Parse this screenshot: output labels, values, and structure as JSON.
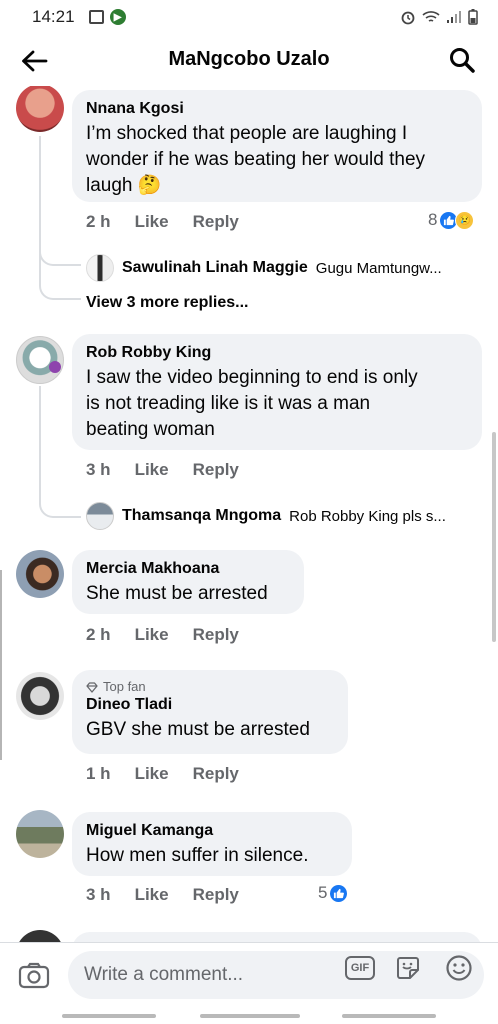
{
  "status_bar": {
    "time": "14:21"
  },
  "header": {
    "title": "MaNgcobo Uzalo"
  },
  "comments": [
    {
      "author": "Nnana Kgosi",
      "text_lines": [
        "I’m shocked that people are laughing I",
        "wonder if he was beating her would they",
        "laugh 🤔"
      ],
      "time": "2 h",
      "like_label": "Like",
      "reply_label": "Reply",
      "reaction_count": "8",
      "reply_preview": {
        "name": "Sawulinah Linah Maggie",
        "snippet": "Gugu Mamtungw..."
      },
      "more_replies": "View 3 more replies..."
    },
    {
      "author": "Rob Robby King",
      "text_lines": [
        "I saw the video beginning to end is only",
        "is not treading like is it was a man",
        "beating woman"
      ],
      "time": "3 h",
      "like_label": "Like",
      "reply_label": "Reply",
      "reply_preview": {
        "name": "Thamsanqa Mngoma",
        "snippet": "Rob Robby King  pls s..."
      }
    },
    {
      "author": "Mercia Makhoana",
      "text_lines": [
        "She must be arrested"
      ],
      "time": "2 h",
      "like_label": "Like",
      "reply_label": "Reply"
    },
    {
      "badge": "Top fan",
      "author": "Dineo Tladi",
      "text_lines": [
        "GBV she must be arrested"
      ],
      "time": "1 h",
      "like_label": "Like",
      "reply_label": "Reply"
    },
    {
      "author": "Miguel Kamanga",
      "text_lines": [
        "How men suffer in silence."
      ],
      "time": "3 h",
      "like_label": "Like",
      "reply_label": "Reply",
      "reaction_count": "5"
    }
  ],
  "composer": {
    "placeholder": "Write a comment...",
    "gif_label": "GIF"
  },
  "colors": {
    "accent": "#1877f2",
    "bubble": "#f0f2f5",
    "meta": "#65676b"
  },
  "icons": [
    "back-arrow-icon",
    "search-icon",
    "like-icon",
    "sad-icon",
    "camera-icon",
    "gif-icon",
    "sticker-icon",
    "emoji-icon",
    "gem-icon"
  ]
}
